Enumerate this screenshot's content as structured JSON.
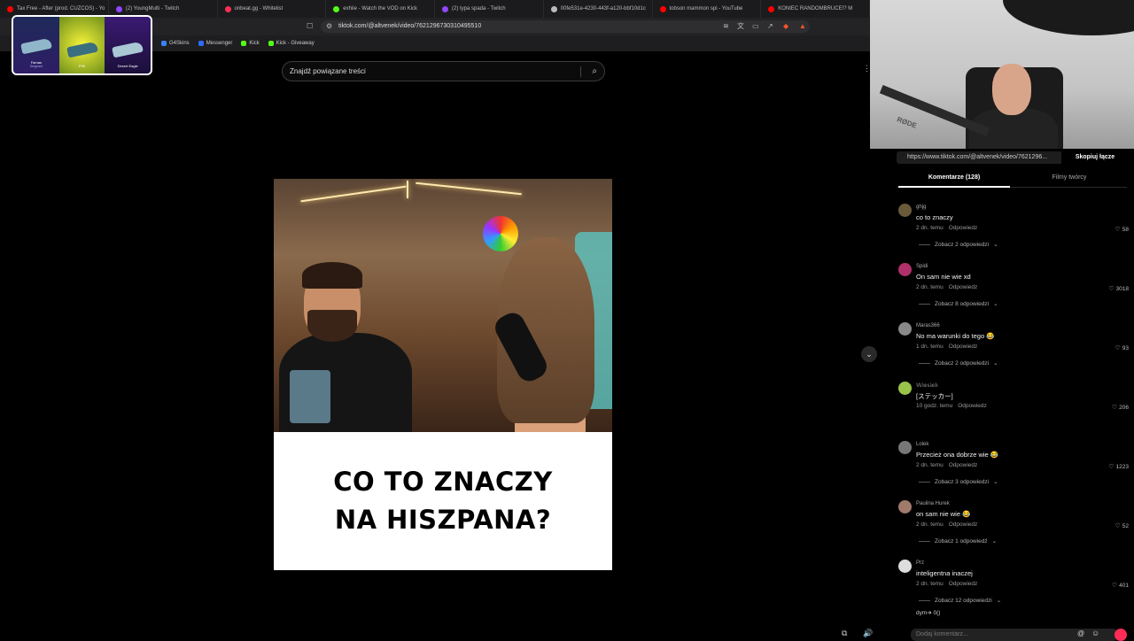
{
  "browser": {
    "tabs": [
      {
        "title": "Tax Free - After (prod. CUZCOS) - Yo",
        "color": "#ff0000"
      },
      {
        "title": "(2) YoungMulti - Twitch",
        "color": "#9146ff"
      },
      {
        "title": "onbeat.gg - Whitelist",
        "color": "#ff2d55"
      },
      {
        "title": "exhiie - Watch the VOD on Kick",
        "color": "#53fc18"
      },
      {
        "title": "(2) typa spada - Twitch",
        "color": "#9146ff"
      },
      {
        "title": "00fe531e-4230-443f-a120-bbf10d1c",
        "color": "#bbbbbb"
      },
      {
        "title": "tobson mammon spi - YouTube",
        "color": "#ff0000"
      },
      {
        "title": "KONIEC RANDOMBRUCE!? M",
        "color": "#ff0000"
      }
    ],
    "url": "tiktok.com/@altvenek/video/7621296730310495510",
    "bookmarks": [
      {
        "label": "G4Skins",
        "color": "#3b82f6"
      },
      {
        "label": "Messenger",
        "color": "#2f6bff"
      },
      {
        "label": "Kick",
        "color": "#53fc18"
      },
      {
        "label": "Kick - Giveaway",
        "color": "#53fc18"
      }
    ]
  },
  "skin_overlay": {
    "items": [
      {
        "name": "Famas",
        "sub": "Sergeant"
      },
      {
        "name": "P90",
        "sub": ""
      },
      {
        "name": "Desert Eagle",
        "sub": ""
      }
    ]
  },
  "tiktok": {
    "search_placeholder": "Znajdź powiązane treści",
    "video": {
      "caption_line1": "CO TO ZNACZY",
      "caption_line2": "NA HISZPANA?"
    },
    "share_link": "https://www.tiktok.com/@altvenek/video/7621296...",
    "copy_link_label": "Skopiuj łącze",
    "tabs": {
      "comments": "Komentarze (128)",
      "creator_videos": "Filmy twórcy"
    },
    "comments": [
      {
        "user": "ghjg",
        "text": "co to znaczy",
        "time": "2 dn. temu",
        "reply": "Odpowiedz",
        "likes": "58",
        "more": "Zobacz 2 odpowiedzi",
        "avatar": "#6b5a3a"
      },
      {
        "user": "Spidi",
        "text": "On sam nie wie xd",
        "time": "2 dn. temu",
        "reply": "Odpowiedz",
        "likes": "3018",
        "more": "Zobacz 8 odpowiedzi",
        "avatar": "#b0306a"
      },
      {
        "user": "Maras366",
        "text": "No ma warunki do tego 😂",
        "time": "1 dn. temu",
        "reply": "Odpowiedz",
        "likes": "93",
        "more": "Zobacz 2 odpowiedzi",
        "avatar": "#888888"
      },
      {
        "user": "𝕎𝕚𝕖𝕤𝕚𝕖𝕜",
        "text": "[ステッカー]",
        "time": "10 godz. temu",
        "reply": "Odpowiedz",
        "likes": "206",
        "more": "",
        "avatar": "#9ac34a"
      },
      {
        "user": "Lolek",
        "text": "Przecież ona dobrze wie 😂",
        "time": "2 dn. temu",
        "reply": "Odpowiedz",
        "likes": "1223",
        "more": "Zobacz 3 odpowiedzi",
        "avatar": "#777777"
      },
      {
        "user": "Paulina Hurek",
        "text": "on sam nie wie 😂",
        "time": "2 dn. temu",
        "reply": "Odpowiedz",
        "likes": "52",
        "more": "Zobacz 1 odpowiedź",
        "avatar": "#a07a6a"
      },
      {
        "user": "Prz",
        "text": "inteligentna inaczej",
        "time": "2 dn. temu",
        "reply": "Odpowiedz",
        "likes": "401",
        "more": "Zobacz 12 odpowiedzi",
        "avatar": "#dddddd"
      }
    ],
    "last_user": "dym➔ 0()",
    "comment_placeholder": "Dodaj komentarz..."
  },
  "webcam": {
    "mic_brand": "RØDE"
  },
  "colors": {
    "tiktok_red": "#fe2c55",
    "background": "#000000"
  }
}
